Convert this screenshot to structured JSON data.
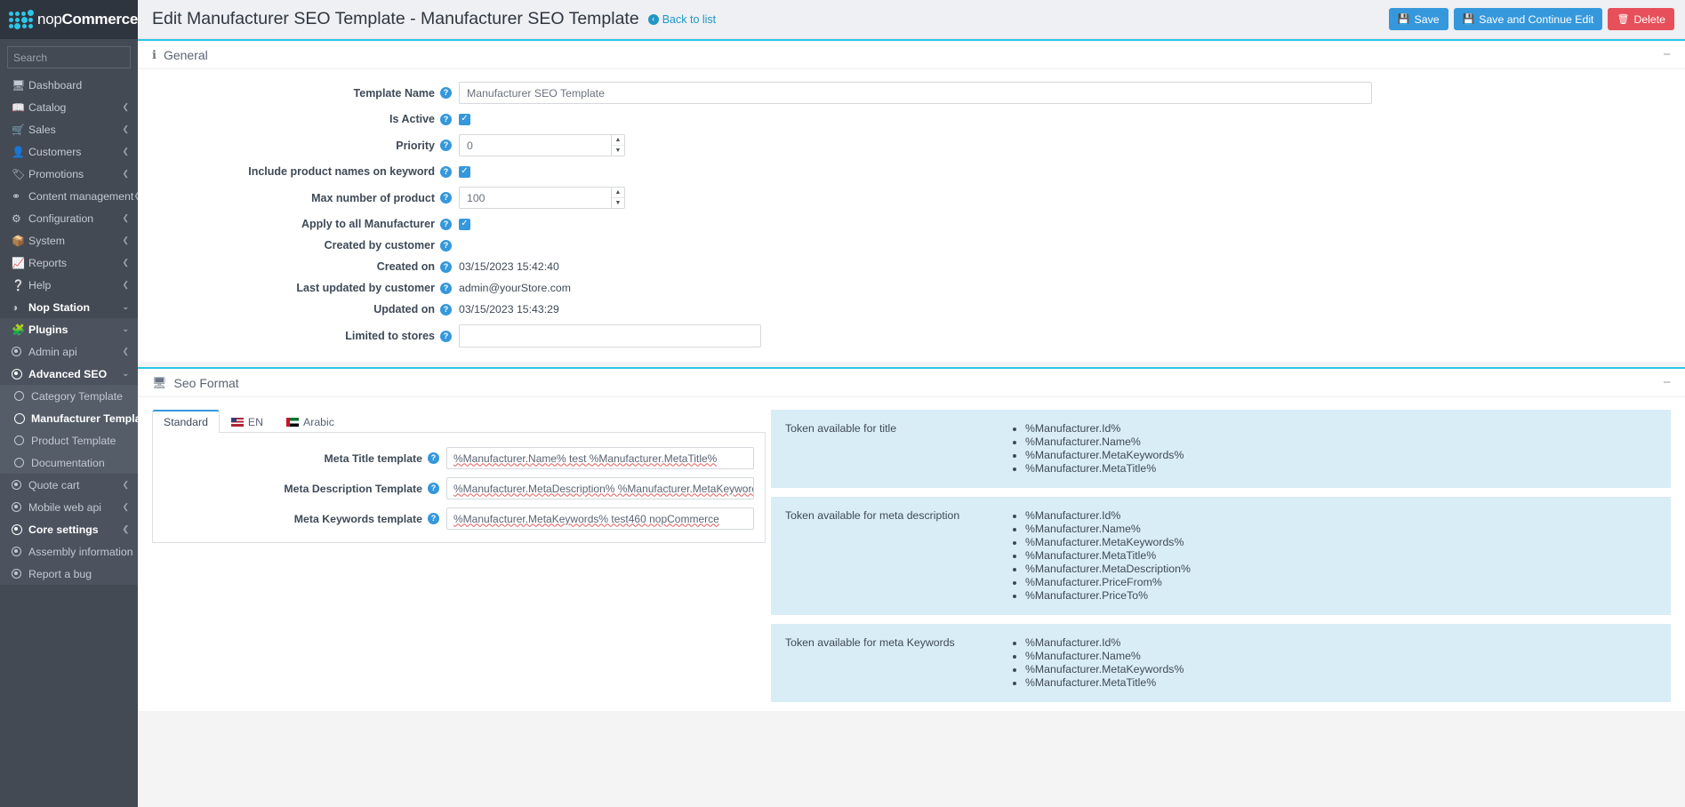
{
  "brand": {
    "name_light": "nop",
    "name_bold": "Commerce"
  },
  "sidebar": {
    "search_placeholder": "Search",
    "items": [
      {
        "label": "Dashboard",
        "icon": "monitor-icon",
        "caret": ""
      },
      {
        "label": "Catalog",
        "icon": "book-icon",
        "caret": "❮"
      },
      {
        "label": "Sales",
        "icon": "cart-icon",
        "caret": "❮"
      },
      {
        "label": "Customers",
        "icon": "user-icon",
        "caret": "❮"
      },
      {
        "label": "Promotions",
        "icon": "tag-icon",
        "caret": "❮"
      },
      {
        "label": "Content management",
        "icon": "sitemap-icon",
        "caret": "❮"
      },
      {
        "label": "Configuration",
        "icon": "gears-icon",
        "caret": "❮"
      },
      {
        "label": "System",
        "icon": "cube-icon",
        "caret": "❮"
      },
      {
        "label": "Reports",
        "icon": "chart-icon",
        "caret": "❮"
      },
      {
        "label": "Help",
        "icon": "question-circle-icon",
        "caret": "❮"
      },
      {
        "label": "Nop Station",
        "icon": "circle-half-icon",
        "caret": "⌄"
      }
    ],
    "plugins": {
      "label": "Plugins",
      "icon": "puzzle-icon",
      "caret": "⌄"
    },
    "sub_items": [
      {
        "label": "Admin api",
        "icon": "radio-filled-icon",
        "caret": "❮",
        "state": "normal"
      },
      {
        "label": "Advanced SEO",
        "icon": "radio-filled-icon",
        "caret": "⌄",
        "state": "open"
      }
    ],
    "seo_children": [
      {
        "label": "Category Template",
        "icon": "radio-empty-icon",
        "state": "normal"
      },
      {
        "label": "Manufacturer Template",
        "icon": "radio-empty-icon",
        "state": "current"
      },
      {
        "label": "Product Template",
        "icon": "radio-empty-icon",
        "state": "normal"
      },
      {
        "label": "Documentation",
        "icon": "radio-empty-icon",
        "state": "normal"
      }
    ],
    "tail_items": [
      {
        "label": "Quote cart",
        "icon": "radio-filled-icon",
        "caret": "❮"
      },
      {
        "label": "Mobile web api",
        "icon": "radio-filled-icon",
        "caret": "❮"
      },
      {
        "label": "Core settings",
        "icon": "radio-filled-icon",
        "caret": "❮"
      },
      {
        "label": "Assembly information",
        "icon": "radio-filled-icon",
        "caret": ""
      },
      {
        "label": "Report a bug",
        "icon": "radio-filled-icon",
        "caret": ""
      }
    ]
  },
  "topbar": {
    "title": "Edit Manufacturer SEO Template - Manufacturer SEO Template",
    "back_label": "Back to list",
    "save_label": "Save",
    "save_continue_label": "Save and Continue Edit",
    "delete_label": "Delete",
    "accent_primary": "#3598dc",
    "accent_danger": "#e7505a"
  },
  "general": {
    "panel_title": "General",
    "collapse_glyph": "−",
    "fields": {
      "template_name": {
        "label": "Template Name",
        "value": "Manufacturer SEO Template"
      },
      "is_active": {
        "label": "Is Active",
        "checked": true
      },
      "priority": {
        "label": "Priority",
        "value": "0"
      },
      "include_product_names": {
        "label": "Include product names on keyword",
        "checked": true
      },
      "max_number_of_product": {
        "label": "Max number of product",
        "value": "100"
      },
      "apply_to_all": {
        "label": "Apply to all Manufacturer",
        "checked": true
      },
      "created_by_customer": {
        "label": "Created by customer",
        "value": ""
      },
      "created_on": {
        "label": "Created on",
        "value": "03/15/2023 15:42:40"
      },
      "last_updated_by_customer": {
        "label": "Last updated by customer",
        "value": "admin@yourStore.com"
      },
      "updated_on": {
        "label": "Updated on",
        "value": "03/15/2023 15:43:29"
      },
      "limited_to_stores": {
        "label": "Limited to stores",
        "value": ""
      }
    }
  },
  "seo_format": {
    "panel_title": "Seo Format",
    "collapse_glyph": "−",
    "tabs": [
      {
        "label": "Standard",
        "flag": "",
        "active": true
      },
      {
        "label": "EN",
        "flag": "flag-us-icon",
        "active": false
      },
      {
        "label": "Arabic",
        "flag": "flag-ae-icon",
        "active": false
      }
    ],
    "rows": [
      {
        "label": "Meta Title template",
        "value": "%Manufacturer.Name% test %Manufacturer.MetaTitle%"
      },
      {
        "label": "Meta Description Template",
        "value": "%Manufacturer.MetaDescription%  %Manufacturer.MetaKeywords% sdfasdf asdfasvf  %Manufacturer.MetaKeyword"
      },
      {
        "label": "Meta Keywords template",
        "value": "%Manufacturer.MetaKeywords% test460 nopCommerce"
      }
    ],
    "token_boxes": [
      {
        "title": "Token available for title",
        "tokens": [
          "%Manufacturer.Id%",
          "%Manufacturer.Name%",
          "%Manufacturer.MetaKeywords%",
          "%Manufacturer.MetaTitle%"
        ]
      },
      {
        "title": "Token available for meta description",
        "tokens": [
          "%Manufacturer.Id%",
          "%Manufacturer.Name%",
          "%Manufacturer.MetaKeywords%",
          "%Manufacturer.MetaTitle%",
          "%Manufacturer.MetaDescription%",
          "%Manufacturer.PriceFrom%",
          "%Manufacturer.PriceTo%"
        ]
      },
      {
        "title": "Token available for meta Keywords",
        "tokens": [
          "%Manufacturer.Id%",
          "%Manufacturer.Name%",
          "%Manufacturer.MetaKeywords%",
          "%Manufacturer.MetaTitle%"
        ]
      }
    ]
  }
}
